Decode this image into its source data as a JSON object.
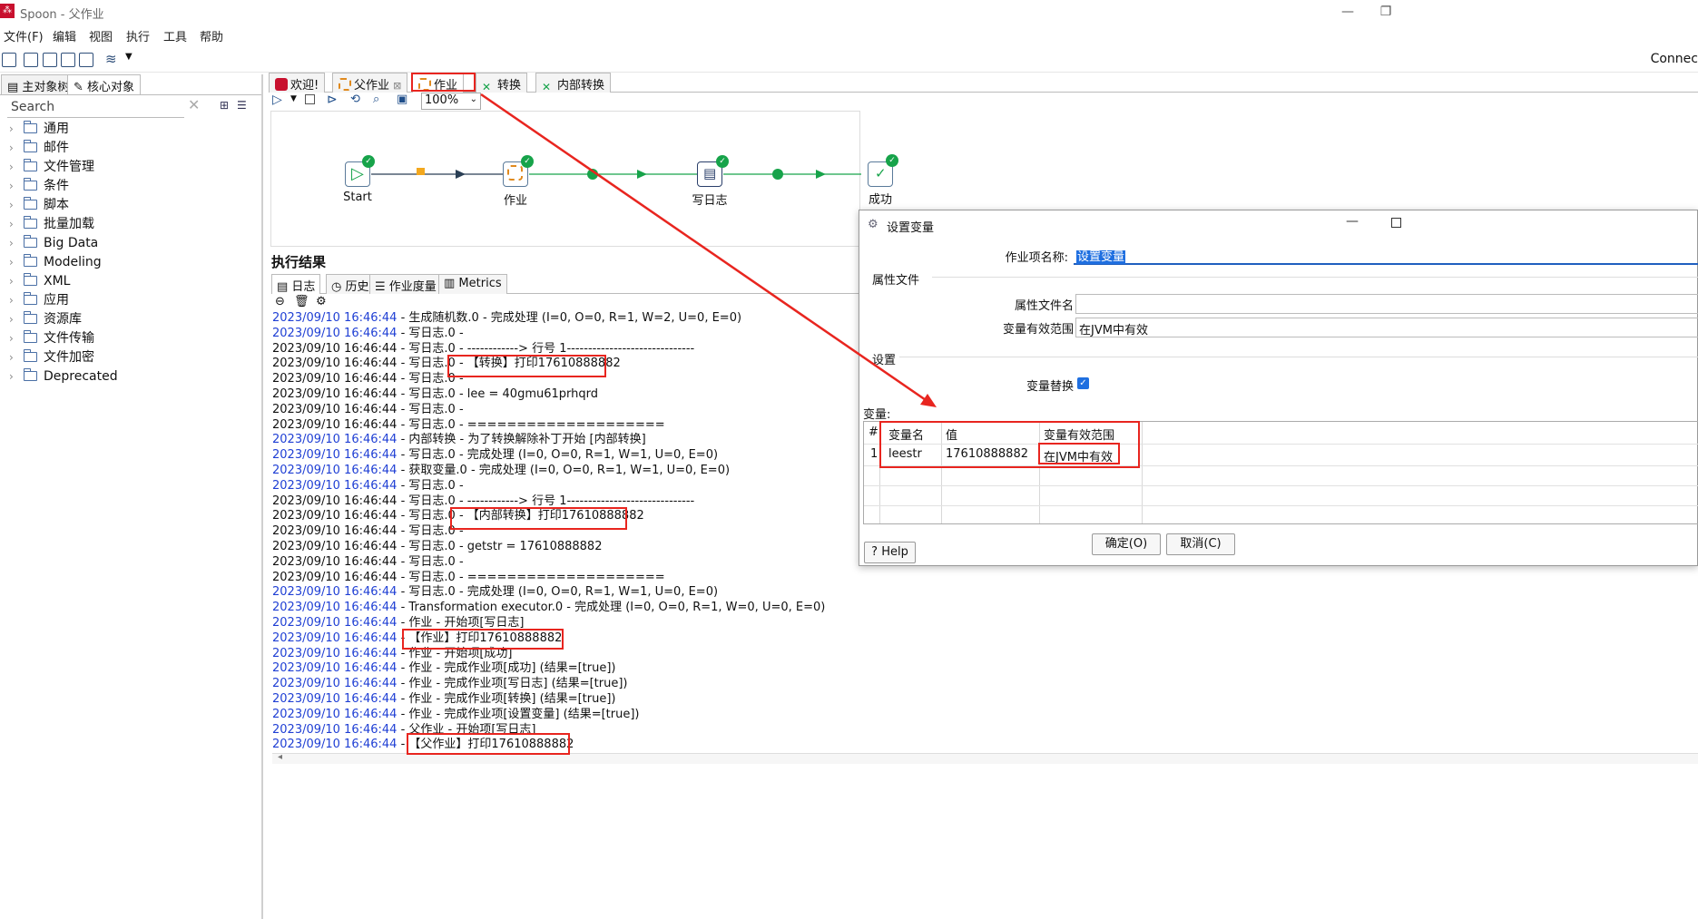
{
  "window": {
    "title": "Spoon - 父作业",
    "app_icon": "spoon-icon"
  },
  "menu": [
    "文件(F)",
    "编辑",
    "视图",
    "执行",
    "工具",
    "帮助"
  ],
  "toolbar": {
    "connect_label": "Connec"
  },
  "left": {
    "tabs": [
      "主对象树",
      "核心对象"
    ],
    "search_placeholder": "Search",
    "tree": [
      "通用",
      "邮件",
      "文件管理",
      "条件",
      "脚本",
      "批量加载",
      "Big Data",
      "Modeling",
      "XML",
      "应用",
      "资源库",
      "文件传输",
      "文件加密",
      "Deprecated"
    ]
  },
  "main_tabs": [
    "欢迎!",
    "父作业",
    "作业",
    "转换",
    "内部转换"
  ],
  "canvas": {
    "zoom": "100%",
    "nodes": [
      "Start",
      "作业",
      "写日志",
      "成功"
    ]
  },
  "results": {
    "title": "执行结果",
    "tabs": [
      "日志",
      "历史",
      "作业度量",
      "Metrics"
    ],
    "log": [
      {
        "ts": "2023/09/10 16:46:44",
        "blue": true,
        "msg": " - 生成随机数.0 - 完成处理 (I=0, O=0, R=1, W=2, U=0, E=0)"
      },
      {
        "ts": "2023/09/10 16:46:44",
        "blue": true,
        "msg": " - 写日志.0 -"
      },
      {
        "ts": "2023/09/10 16:46:44",
        "blue": false,
        "msg": " - 写日志.0 - ------------> 行号 1------------------------------"
      },
      {
        "ts": "2023/09/10 16:46:44",
        "blue": false,
        "msg": " - 写日志.0 - 【转换】打印17610888882"
      },
      {
        "ts": "2023/09/10 16:46:44",
        "blue": false,
        "msg": " - 写日志.0 -"
      },
      {
        "ts": "2023/09/10 16:46:44",
        "blue": false,
        "msg": " - 写日志.0 - lee = 40gmu61prhqrd"
      },
      {
        "ts": "2023/09/10 16:46:44",
        "blue": false,
        "msg": " - 写日志.0 -"
      },
      {
        "ts": "2023/09/10 16:46:44",
        "blue": false,
        "msg": " - 写日志.0 - ===================="
      },
      {
        "ts": "2023/09/10 16:46:44",
        "blue": true,
        "msg": " - 内部转换 - 为了转换解除补丁开始  [内部转换]"
      },
      {
        "ts": "2023/09/10 16:46:44",
        "blue": true,
        "msg": " - 写日志.0 - 完成处理 (I=0, O=0, R=1, W=1, U=0, E=0)"
      },
      {
        "ts": "2023/09/10 16:46:44",
        "blue": true,
        "msg": " - 获取变量.0 - 完成处理 (I=0, O=0, R=1, W=1, U=0, E=0)"
      },
      {
        "ts": "2023/09/10 16:46:44",
        "blue": true,
        "msg": " - 写日志.0 -"
      },
      {
        "ts": "2023/09/10 16:46:44",
        "blue": false,
        "msg": " - 写日志.0 - ------------> 行号 1------------------------------"
      },
      {
        "ts": "2023/09/10 16:46:44",
        "blue": false,
        "msg": " - 写日志.0 - 【内部转换】打印17610888882"
      },
      {
        "ts": "2023/09/10 16:46:44",
        "blue": false,
        "msg": " - 写日志.0 -"
      },
      {
        "ts": "2023/09/10 16:46:44",
        "blue": false,
        "msg": " - 写日志.0 - getstr = 17610888882"
      },
      {
        "ts": "2023/09/10 16:46:44",
        "blue": false,
        "msg": " - 写日志.0 -"
      },
      {
        "ts": "2023/09/10 16:46:44",
        "blue": false,
        "msg": " - 写日志.0 - ===================="
      },
      {
        "ts": "2023/09/10 16:46:44",
        "blue": true,
        "msg": " - 写日志.0 - 完成处理 (I=0, O=0, R=1, W=1, U=0, E=0)"
      },
      {
        "ts": "2023/09/10 16:46:44",
        "blue": true,
        "msg": " - Transformation executor.0 - 完成处理 (I=0, O=0, R=1, W=0, U=0, E=0)"
      },
      {
        "ts": "2023/09/10 16:46:44",
        "blue": true,
        "msg": " - 作业 - 开始项[写日志]"
      },
      {
        "ts": "2023/09/10 16:46:44",
        "blue": true,
        "msg": " - 【作业】打印17610888882"
      },
      {
        "ts": "2023/09/10 16:46:44",
        "blue": true,
        "msg": " - 作业 - 开始项[成功]"
      },
      {
        "ts": "2023/09/10 16:46:44",
        "blue": true,
        "msg": " - 作业 - 完成作业项[成功] (结果=[true])"
      },
      {
        "ts": "2023/09/10 16:46:44",
        "blue": true,
        "msg": " - 作业 - 完成作业项[写日志] (结果=[true])"
      },
      {
        "ts": "2023/09/10 16:46:44",
        "blue": true,
        "msg": " - 作业 - 完成作业项[转换] (结果=[true])"
      },
      {
        "ts": "2023/09/10 16:46:44",
        "blue": true,
        "msg": " - 作业 - 完成作业项[设置变量] (结果=[true])"
      },
      {
        "ts": "2023/09/10 16:46:44",
        "blue": true,
        "msg": " - 父作业 - 开始项[写日志]"
      },
      {
        "ts": "2023/09/10 16:46:44",
        "blue": true,
        "msg": " - 【父作业】打印17610888882"
      }
    ]
  },
  "dialog": {
    "title": "设置变量",
    "job_name_label": "作业项名称:",
    "job_name_value": "设置变量",
    "group_props": "属性文件",
    "prop_file_label": "属性文件名",
    "prop_file_value": "",
    "scope_label": "变量有效范围",
    "scope_value": "在JVM中有效",
    "group_settings": "设置",
    "replace_label": "变量替换",
    "vars_label": "变量:",
    "table": {
      "headers": [
        "#",
        "变量名",
        "值",
        "变量有效范围"
      ],
      "rows": [
        [
          "1",
          "leestr",
          "17610888882",
          "在JVM中有效"
        ]
      ]
    },
    "help": "Help",
    "ok": "确定(O)",
    "cancel": "取消(C)"
  }
}
